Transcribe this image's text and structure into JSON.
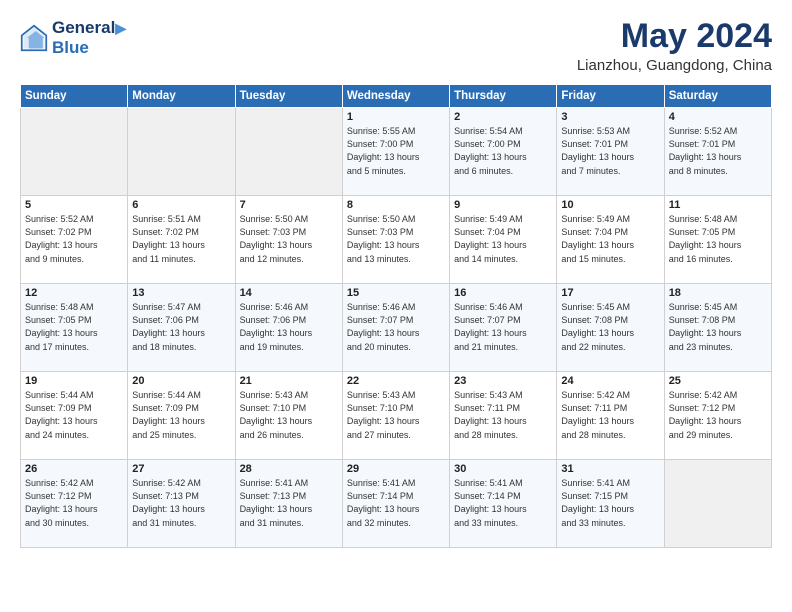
{
  "header": {
    "logo_line1": "General",
    "logo_line2": "Blue",
    "main_title": "May 2024",
    "subtitle": "Lianzhou, Guangdong, China"
  },
  "weekdays": [
    "Sunday",
    "Monday",
    "Tuesday",
    "Wednesday",
    "Thursday",
    "Friday",
    "Saturday"
  ],
  "weeks": [
    [
      {
        "day": "",
        "info": ""
      },
      {
        "day": "",
        "info": ""
      },
      {
        "day": "",
        "info": ""
      },
      {
        "day": "1",
        "info": "Sunrise: 5:55 AM\nSunset: 7:00 PM\nDaylight: 13 hours\nand 5 minutes."
      },
      {
        "day": "2",
        "info": "Sunrise: 5:54 AM\nSunset: 7:00 PM\nDaylight: 13 hours\nand 6 minutes."
      },
      {
        "day": "3",
        "info": "Sunrise: 5:53 AM\nSunset: 7:01 PM\nDaylight: 13 hours\nand 7 minutes."
      },
      {
        "day": "4",
        "info": "Sunrise: 5:52 AM\nSunset: 7:01 PM\nDaylight: 13 hours\nand 8 minutes."
      }
    ],
    [
      {
        "day": "5",
        "info": "Sunrise: 5:52 AM\nSunset: 7:02 PM\nDaylight: 13 hours\nand 9 minutes."
      },
      {
        "day": "6",
        "info": "Sunrise: 5:51 AM\nSunset: 7:02 PM\nDaylight: 13 hours\nand 11 minutes."
      },
      {
        "day": "7",
        "info": "Sunrise: 5:50 AM\nSunset: 7:03 PM\nDaylight: 13 hours\nand 12 minutes."
      },
      {
        "day": "8",
        "info": "Sunrise: 5:50 AM\nSunset: 7:03 PM\nDaylight: 13 hours\nand 13 minutes."
      },
      {
        "day": "9",
        "info": "Sunrise: 5:49 AM\nSunset: 7:04 PM\nDaylight: 13 hours\nand 14 minutes."
      },
      {
        "day": "10",
        "info": "Sunrise: 5:49 AM\nSunset: 7:04 PM\nDaylight: 13 hours\nand 15 minutes."
      },
      {
        "day": "11",
        "info": "Sunrise: 5:48 AM\nSunset: 7:05 PM\nDaylight: 13 hours\nand 16 minutes."
      }
    ],
    [
      {
        "day": "12",
        "info": "Sunrise: 5:48 AM\nSunset: 7:05 PM\nDaylight: 13 hours\nand 17 minutes."
      },
      {
        "day": "13",
        "info": "Sunrise: 5:47 AM\nSunset: 7:06 PM\nDaylight: 13 hours\nand 18 minutes."
      },
      {
        "day": "14",
        "info": "Sunrise: 5:46 AM\nSunset: 7:06 PM\nDaylight: 13 hours\nand 19 minutes."
      },
      {
        "day": "15",
        "info": "Sunrise: 5:46 AM\nSunset: 7:07 PM\nDaylight: 13 hours\nand 20 minutes."
      },
      {
        "day": "16",
        "info": "Sunrise: 5:46 AM\nSunset: 7:07 PM\nDaylight: 13 hours\nand 21 minutes."
      },
      {
        "day": "17",
        "info": "Sunrise: 5:45 AM\nSunset: 7:08 PM\nDaylight: 13 hours\nand 22 minutes."
      },
      {
        "day": "18",
        "info": "Sunrise: 5:45 AM\nSunset: 7:08 PM\nDaylight: 13 hours\nand 23 minutes."
      }
    ],
    [
      {
        "day": "19",
        "info": "Sunrise: 5:44 AM\nSunset: 7:09 PM\nDaylight: 13 hours\nand 24 minutes."
      },
      {
        "day": "20",
        "info": "Sunrise: 5:44 AM\nSunset: 7:09 PM\nDaylight: 13 hours\nand 25 minutes."
      },
      {
        "day": "21",
        "info": "Sunrise: 5:43 AM\nSunset: 7:10 PM\nDaylight: 13 hours\nand 26 minutes."
      },
      {
        "day": "22",
        "info": "Sunrise: 5:43 AM\nSunset: 7:10 PM\nDaylight: 13 hours\nand 27 minutes."
      },
      {
        "day": "23",
        "info": "Sunrise: 5:43 AM\nSunset: 7:11 PM\nDaylight: 13 hours\nand 28 minutes."
      },
      {
        "day": "24",
        "info": "Sunrise: 5:42 AM\nSunset: 7:11 PM\nDaylight: 13 hours\nand 28 minutes."
      },
      {
        "day": "25",
        "info": "Sunrise: 5:42 AM\nSunset: 7:12 PM\nDaylight: 13 hours\nand 29 minutes."
      }
    ],
    [
      {
        "day": "26",
        "info": "Sunrise: 5:42 AM\nSunset: 7:12 PM\nDaylight: 13 hours\nand 30 minutes."
      },
      {
        "day": "27",
        "info": "Sunrise: 5:42 AM\nSunset: 7:13 PM\nDaylight: 13 hours\nand 31 minutes."
      },
      {
        "day": "28",
        "info": "Sunrise: 5:41 AM\nSunset: 7:13 PM\nDaylight: 13 hours\nand 31 minutes."
      },
      {
        "day": "29",
        "info": "Sunrise: 5:41 AM\nSunset: 7:14 PM\nDaylight: 13 hours\nand 32 minutes."
      },
      {
        "day": "30",
        "info": "Sunrise: 5:41 AM\nSunset: 7:14 PM\nDaylight: 13 hours\nand 33 minutes."
      },
      {
        "day": "31",
        "info": "Sunrise: 5:41 AM\nSunset: 7:15 PM\nDaylight: 13 hours\nand 33 minutes."
      },
      {
        "day": "",
        "info": ""
      }
    ]
  ]
}
